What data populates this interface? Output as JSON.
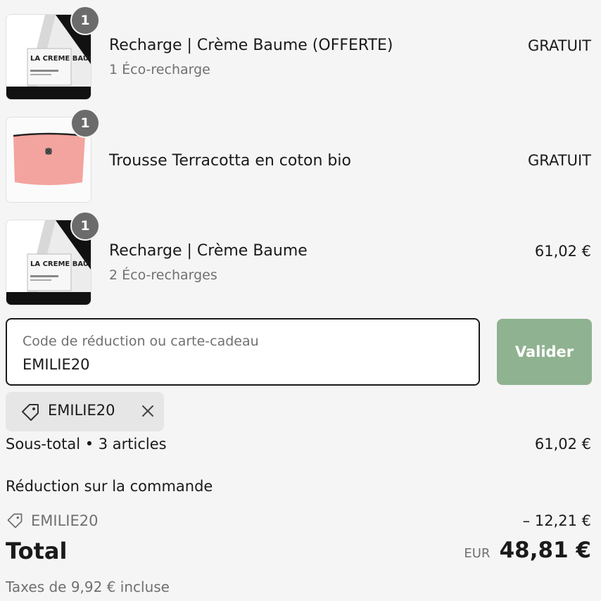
{
  "items": [
    {
      "quantity": "1",
      "name": "Recharge | Crème Baume (OFFERTE)",
      "variant": "1 Éco-recharge",
      "price": "GRATUIT",
      "image_text": "LA CREME BAUME"
    },
    {
      "quantity": "1",
      "name": "Trousse Terracotta en coton bio",
      "variant": "",
      "price": "GRATUIT"
    },
    {
      "quantity": "1",
      "name": "Recharge | Crème Baume",
      "variant": "2 Éco-recharges",
      "price": "61,02 €",
      "image_text": "LA CREME BAUME"
    }
  ],
  "discount_field": {
    "placeholder": "Code de réduction ou carte-cadeau",
    "value": "EMILIE20"
  },
  "validate_button": {
    "label": "Valider",
    "color": "#8fb290"
  },
  "applied_code": {
    "label": "EMILIE20",
    "icon": "tag-icon",
    "remove_icon": "close-icon"
  },
  "summary": {
    "subtotal_label": "Sous-total • 3 articles",
    "subtotal_value": "61,02 €",
    "discount_heading": "Réduction sur la commande",
    "discount_code": "EMILIE20",
    "discount_value": "– 12,21 €",
    "total_label": "Total",
    "currency": "EUR",
    "total_value": "48,81 €",
    "taxes": "Taxes de 9,92 € incluse"
  },
  "colors": {
    "background": "#f5f5f5",
    "badge": "#6b6b6b",
    "pouch": "#f3a49e"
  }
}
